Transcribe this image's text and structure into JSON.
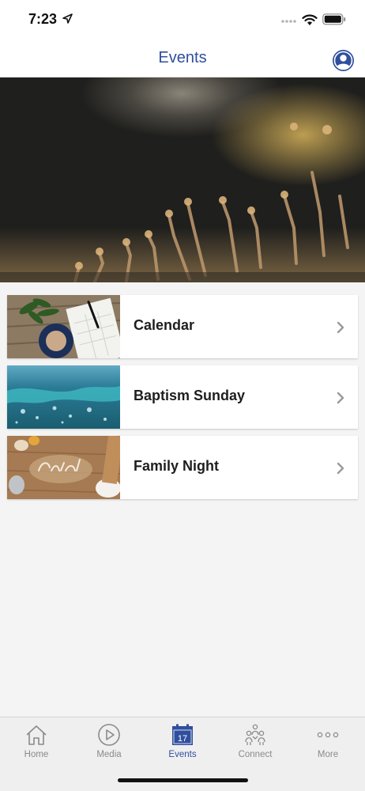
{
  "status_bar": {
    "time": "7:23"
  },
  "header": {
    "title": "Events"
  },
  "events": [
    {
      "label": "Calendar"
    },
    {
      "label": "Baptism Sunday"
    },
    {
      "label": "Family Night"
    }
  ],
  "tab_bar": {
    "tabs": [
      {
        "label": "Home",
        "icon": "home-icon"
      },
      {
        "label": "Media",
        "icon": "play-icon"
      },
      {
        "label": "Events",
        "icon": "calendar-icon",
        "calendar_day": "17"
      },
      {
        "label": "Connect",
        "icon": "people-icon"
      },
      {
        "label": "More",
        "icon": "more-icon"
      }
    ],
    "active": "Events"
  },
  "colors": {
    "accent": "#2f4f9e",
    "inactive_tab": "#8a8a8a",
    "background": "#f4f4f4"
  }
}
